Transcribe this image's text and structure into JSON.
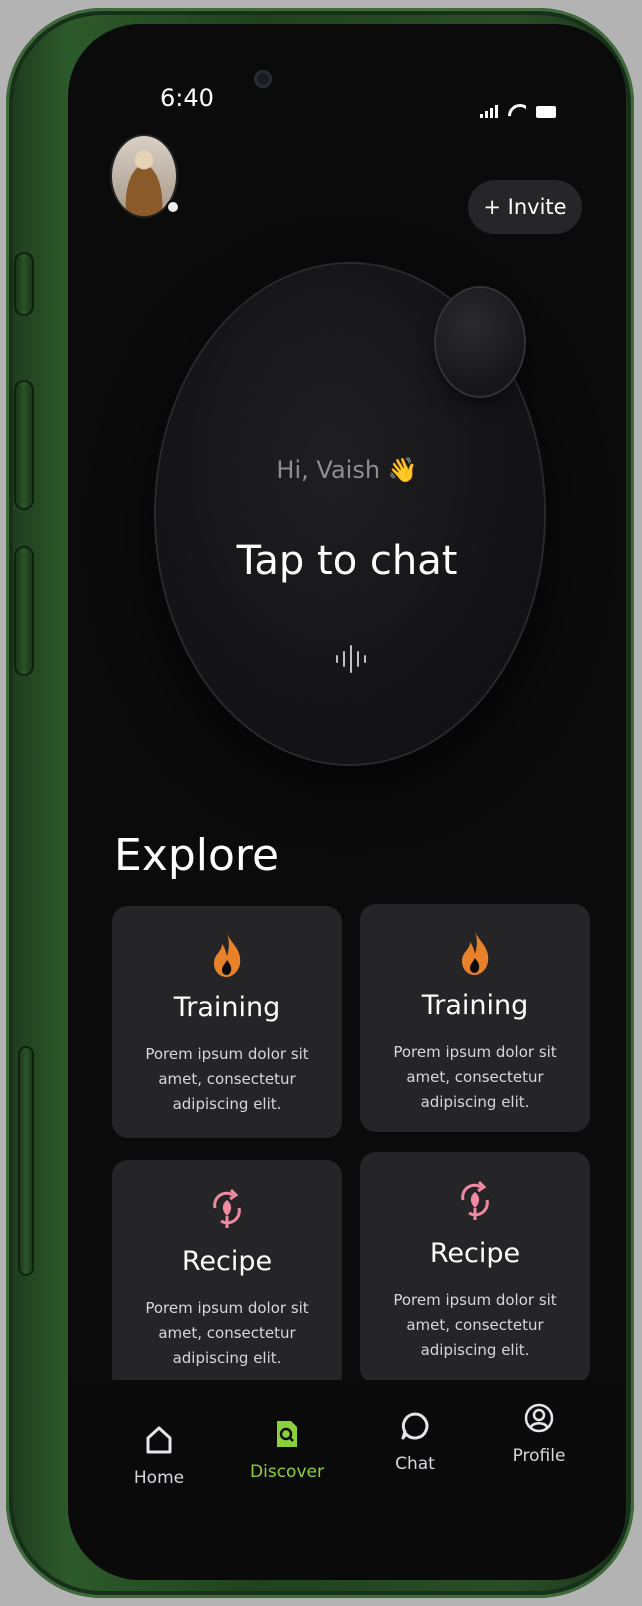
{
  "status": {
    "time": "6:40"
  },
  "header": {
    "invite_label": "+ Invite"
  },
  "hero": {
    "greeting": "Hi, Vaish 👋",
    "prompt": "Tap to chat"
  },
  "explore": {
    "title": "Explore",
    "cards": [
      {
        "title": "Training",
        "description": "Porem ipsum dolor sit amet, consectetur adipiscing elit.",
        "icon": "flame-icon"
      },
      {
        "title": "Training",
        "description": "Porem ipsum dolor sit amet, consectetur adipiscing elit.",
        "icon": "flame-icon"
      },
      {
        "title": "Recipe",
        "description": "Porem ipsum dolor sit amet, consectetur adipiscing elit.",
        "icon": "recipe-icon"
      },
      {
        "title": "Recipe",
        "description": "Porem ipsum dolor sit amet, consectetur adipiscing elit.",
        "icon": "recipe-icon"
      }
    ]
  },
  "nav": {
    "items": [
      {
        "label": "Home",
        "icon": "home-icon"
      },
      {
        "label": "Discover",
        "icon": "discover-icon",
        "active": true
      },
      {
        "label": "Chat",
        "icon": "chat-icon"
      },
      {
        "label": "Profile",
        "icon": "profile-icon"
      }
    ]
  },
  "colors": {
    "accent": "#8bd13a",
    "flame": "#e8822a",
    "recipe": "#f08aa2",
    "background": "#0b0b0c",
    "card": "#252527"
  }
}
